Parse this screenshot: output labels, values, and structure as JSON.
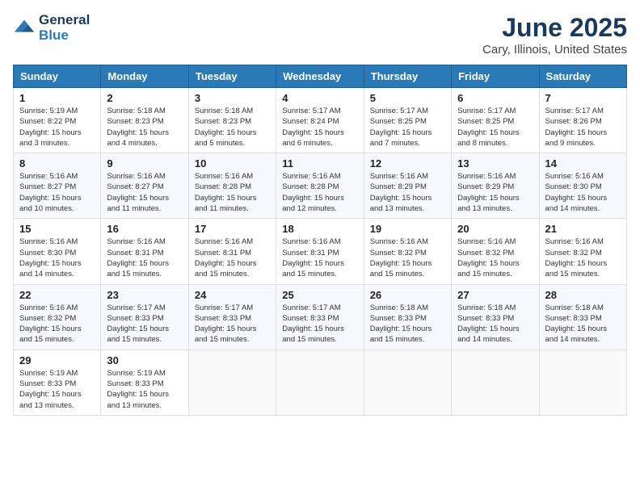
{
  "header": {
    "logo_line1": "General",
    "logo_line2": "Blue",
    "month_year": "June 2025",
    "location": "Cary, Illinois, United States"
  },
  "weekdays": [
    "Sunday",
    "Monday",
    "Tuesday",
    "Wednesday",
    "Thursday",
    "Friday",
    "Saturday"
  ],
  "weeks": [
    [
      {
        "day": "1",
        "sunrise": "5:19 AM",
        "sunset": "8:22 PM",
        "daylight": "15 hours and 3 minutes."
      },
      {
        "day": "2",
        "sunrise": "5:18 AM",
        "sunset": "8:23 PM",
        "daylight": "15 hours and 4 minutes."
      },
      {
        "day": "3",
        "sunrise": "5:18 AM",
        "sunset": "8:23 PM",
        "daylight": "15 hours and 5 minutes."
      },
      {
        "day": "4",
        "sunrise": "5:17 AM",
        "sunset": "8:24 PM",
        "daylight": "15 hours and 6 minutes."
      },
      {
        "day": "5",
        "sunrise": "5:17 AM",
        "sunset": "8:25 PM",
        "daylight": "15 hours and 7 minutes."
      },
      {
        "day": "6",
        "sunrise": "5:17 AM",
        "sunset": "8:25 PM",
        "daylight": "15 hours and 8 minutes."
      },
      {
        "day": "7",
        "sunrise": "5:17 AM",
        "sunset": "8:26 PM",
        "daylight": "15 hours and 9 minutes."
      }
    ],
    [
      {
        "day": "8",
        "sunrise": "5:16 AM",
        "sunset": "8:27 PM",
        "daylight": "15 hours and 10 minutes."
      },
      {
        "day": "9",
        "sunrise": "5:16 AM",
        "sunset": "8:27 PM",
        "daylight": "15 hours and 11 minutes."
      },
      {
        "day": "10",
        "sunrise": "5:16 AM",
        "sunset": "8:28 PM",
        "daylight": "15 hours and 11 minutes."
      },
      {
        "day": "11",
        "sunrise": "5:16 AM",
        "sunset": "8:28 PM",
        "daylight": "15 hours and 12 minutes."
      },
      {
        "day": "12",
        "sunrise": "5:16 AM",
        "sunset": "8:29 PM",
        "daylight": "15 hours and 13 minutes."
      },
      {
        "day": "13",
        "sunrise": "5:16 AM",
        "sunset": "8:29 PM",
        "daylight": "15 hours and 13 minutes."
      },
      {
        "day": "14",
        "sunrise": "5:16 AM",
        "sunset": "8:30 PM",
        "daylight": "15 hours and 14 minutes."
      }
    ],
    [
      {
        "day": "15",
        "sunrise": "5:16 AM",
        "sunset": "8:30 PM",
        "daylight": "15 hours and 14 minutes."
      },
      {
        "day": "16",
        "sunrise": "5:16 AM",
        "sunset": "8:31 PM",
        "daylight": "15 hours and 15 minutes."
      },
      {
        "day": "17",
        "sunrise": "5:16 AM",
        "sunset": "8:31 PM",
        "daylight": "15 hours and 15 minutes."
      },
      {
        "day": "18",
        "sunrise": "5:16 AM",
        "sunset": "8:31 PM",
        "daylight": "15 hours and 15 minutes."
      },
      {
        "day": "19",
        "sunrise": "5:16 AM",
        "sunset": "8:32 PM",
        "daylight": "15 hours and 15 minutes."
      },
      {
        "day": "20",
        "sunrise": "5:16 AM",
        "sunset": "8:32 PM",
        "daylight": "15 hours and 15 minutes."
      },
      {
        "day": "21",
        "sunrise": "5:16 AM",
        "sunset": "8:32 PM",
        "daylight": "15 hours and 15 minutes."
      }
    ],
    [
      {
        "day": "22",
        "sunrise": "5:16 AM",
        "sunset": "8:32 PM",
        "daylight": "15 hours and 15 minutes."
      },
      {
        "day": "23",
        "sunrise": "5:17 AM",
        "sunset": "8:33 PM",
        "daylight": "15 hours and 15 minutes."
      },
      {
        "day": "24",
        "sunrise": "5:17 AM",
        "sunset": "8:33 PM",
        "daylight": "15 hours and 15 minutes."
      },
      {
        "day": "25",
        "sunrise": "5:17 AM",
        "sunset": "8:33 PM",
        "daylight": "15 hours and 15 minutes."
      },
      {
        "day": "26",
        "sunrise": "5:18 AM",
        "sunset": "8:33 PM",
        "daylight": "15 hours and 15 minutes."
      },
      {
        "day": "27",
        "sunrise": "5:18 AM",
        "sunset": "8:33 PM",
        "daylight": "15 hours and 14 minutes."
      },
      {
        "day": "28",
        "sunrise": "5:18 AM",
        "sunset": "8:33 PM",
        "daylight": "15 hours and 14 minutes."
      }
    ],
    [
      {
        "day": "29",
        "sunrise": "5:19 AM",
        "sunset": "8:33 PM",
        "daylight": "15 hours and 13 minutes."
      },
      {
        "day": "30",
        "sunrise": "5:19 AM",
        "sunset": "8:33 PM",
        "daylight": "15 hours and 13 minutes."
      },
      null,
      null,
      null,
      null,
      null
    ]
  ]
}
